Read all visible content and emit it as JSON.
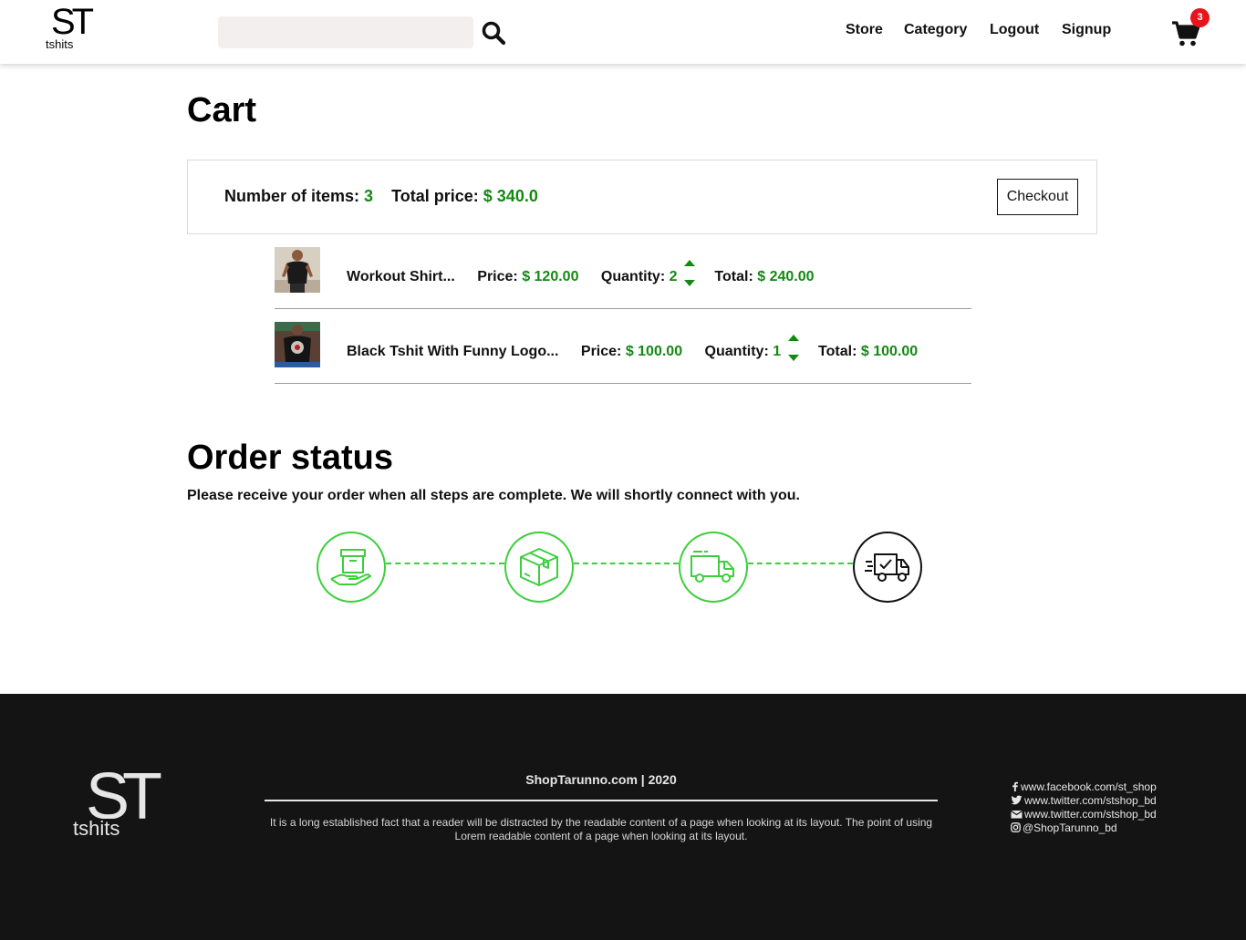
{
  "header": {
    "logo_letters": "ST",
    "logo_sub": "tshits",
    "search": {
      "value": "",
      "placeholder": ""
    },
    "nav": [
      "Store",
      "Category",
      "Logout",
      "Signup"
    ],
    "cart_count": "3"
  },
  "cart": {
    "title": "Cart",
    "summary": {
      "items_label": "Number of items:",
      "items_value": "3",
      "total_label": "Total price:",
      "total_value": "$ 340.0"
    },
    "checkout_label": "Checkout",
    "items": [
      {
        "name": "Workout Shirt...",
        "price_label": "Price:",
        "price": "$ 120.00",
        "qty_label": "Quantity:",
        "qty": "2",
        "total_label": "Total:",
        "total": "$ 240.00"
      },
      {
        "name": "Black Tshit With Funny Logo...",
        "price_label": "Price:",
        "price": "$ 100.00",
        "qty_label": "Quantity:",
        "qty": "1",
        "total_label": "Total:",
        "total": "$ 100.00"
      }
    ]
  },
  "order_status": {
    "title": "Order status",
    "subtitle": "Please receive your order when all steps are complete. We will shortly connect with you.",
    "steps": [
      {
        "icon": "hand-box-icon",
        "complete": true
      },
      {
        "icon": "package-icon",
        "complete": true
      },
      {
        "icon": "truck-icon",
        "complete": true
      },
      {
        "icon": "delivery-check-icon",
        "complete": false
      }
    ]
  },
  "footer": {
    "logo_letters": "ST",
    "logo_sub": "tshits",
    "title": "ShopTarunno.com | 2020",
    "text": "It is a long established fact that a reader will be distracted by the readable content of a page when looking at its layout. The point of using Lorem readable content of a page when looking at its layout.",
    "social": [
      {
        "icon": "facebook-icon",
        "text": "www.facebook.com/st_shop"
      },
      {
        "icon": "twitter-icon",
        "text": "www.twitter.com/stshop_bd"
      },
      {
        "icon": "envelope-icon",
        "text": "www.twitter.com/stshop_bd"
      },
      {
        "icon": "instagram-icon",
        "text": "@ShopTarunno_bd"
      }
    ]
  },
  "colors": {
    "accent_green": "#128a12",
    "step_green": "#3ccf3c",
    "badge_red": "#e8141c",
    "footer_bg": "#141414"
  }
}
